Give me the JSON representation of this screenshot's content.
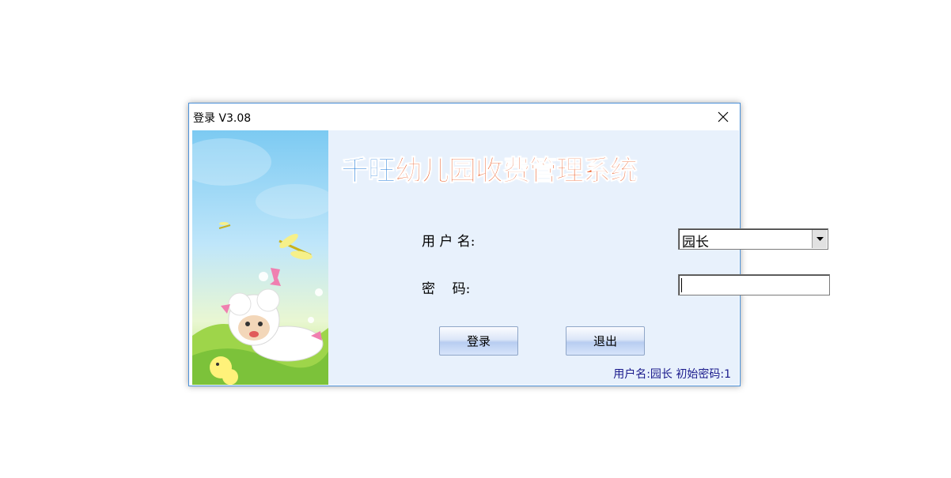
{
  "window": {
    "title": "登录 V3.08"
  },
  "header": {
    "brand": "千旺",
    "system_name": "幼儿园收费管理系统"
  },
  "form": {
    "username_label": "用 户 名:",
    "username_value": "园长",
    "password_label": "密    码:",
    "password_value": ""
  },
  "buttons": {
    "login": "登录",
    "exit": "退出"
  },
  "hint": "用户名:园长 初始密码:1",
  "colors": {
    "brand_blue": "#1e7ad9",
    "brand_orange": "#e9531a",
    "hint_text": "#1a1a8c",
    "panel_bg": "#e8f1fc"
  }
}
